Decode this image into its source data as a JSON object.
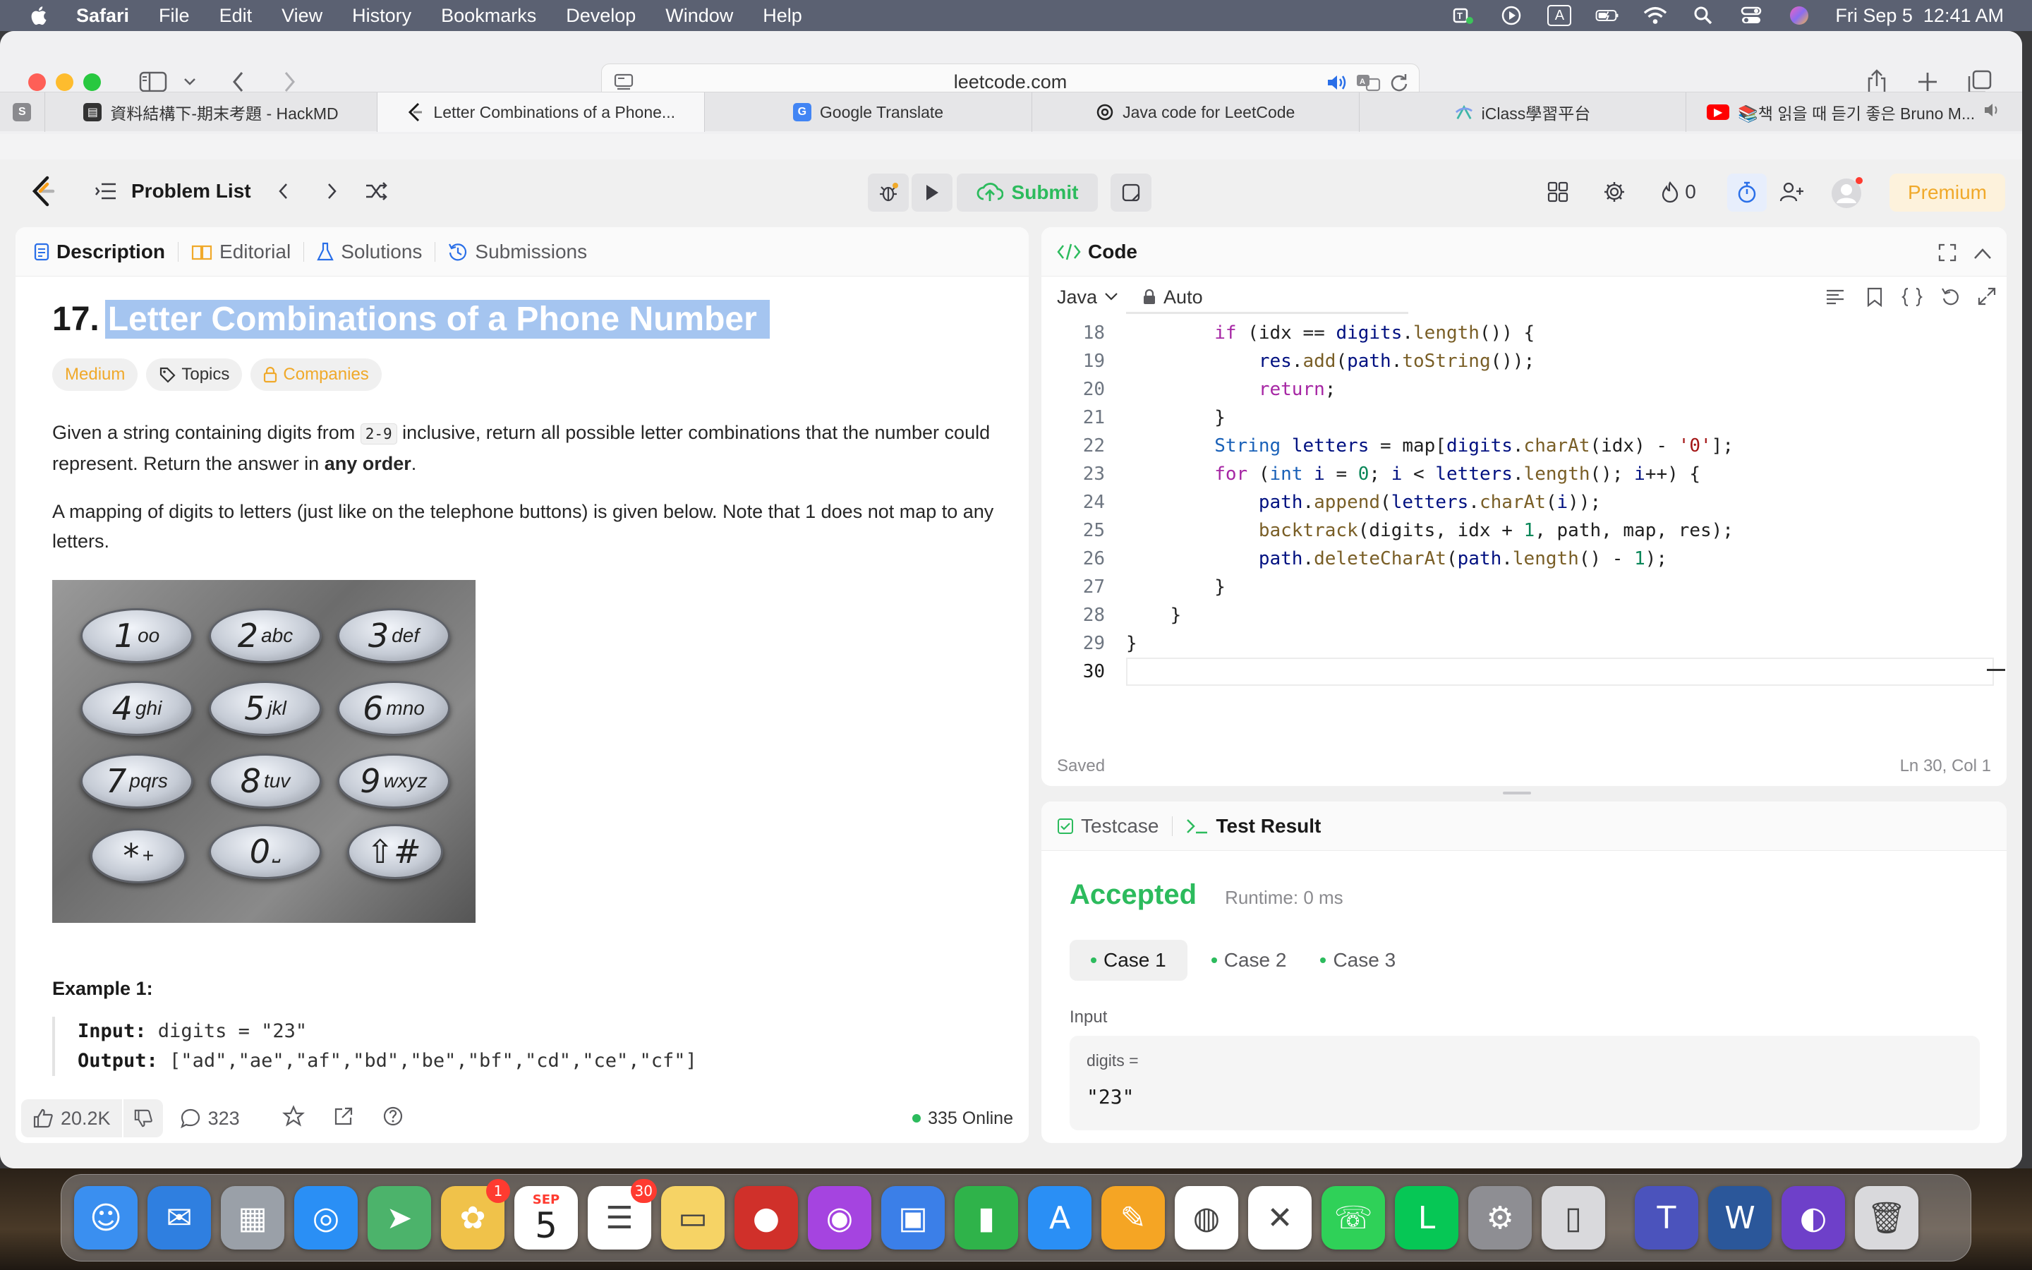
{
  "menubar": {
    "app": "Safari",
    "items": [
      "File",
      "Edit",
      "View",
      "History",
      "Bookmarks",
      "Develop",
      "Window",
      "Help"
    ],
    "clock": "Fri Sep 5  12:41 AM",
    "input_indicator": "A"
  },
  "browser": {
    "url": "leetcode.com",
    "tabs": [
      {
        "label": "資料結構下-期末考題 - HackMD",
        "icon": "hackmd-icon",
        "color": "#333333"
      },
      {
        "label": "Letter Combinations of a Phone...",
        "icon": "leetcode-icon",
        "color": "#f89f1b"
      },
      {
        "label": "Google Translate",
        "icon": "google-translate-icon",
        "color": "#4285f4"
      },
      {
        "label": "Java code for LeetCode",
        "icon": "chatgpt-icon",
        "color": "#222222"
      },
      {
        "label": "iClass學習平台",
        "icon": "iclass-icon",
        "color": "#3fb6a8"
      },
      {
        "label": "📚책 읽을 때 듣기 좋은 Bruno M...",
        "icon": "youtube-icon",
        "color": "#ff0000"
      }
    ],
    "pinned_tab": "S"
  },
  "leetcode": {
    "nav": {
      "problem_list": "Problem List",
      "submit": "Submit",
      "streak": "0",
      "premium": "Premium"
    },
    "description_tabs": [
      "Description",
      "Editorial",
      "Solutions",
      "Submissions"
    ],
    "problem": {
      "number": "17.",
      "title": "Letter Combinations of a Phone Number",
      "difficulty": "Medium",
      "topics": "Topics",
      "companies": "Companies",
      "para1_a": "Given a string containing digits from ",
      "para1_code": "2-9",
      "para1_b": " inclusive, return all possible letter combinations that the number could represent. Return the answer in ",
      "para1_bold": "any order",
      "para1_c": ".",
      "para2": "A mapping of digits to letters (just like on the telephone buttons) is given below. Note that 1 does not map to any letters.",
      "example_heading": "Example 1:",
      "example_input_label": "Input:",
      "example_input": " digits = \"23\"",
      "example_output_label": "Output:",
      "example_output": " [\"ad\",\"ae\",\"af\",\"bd\",\"be\",\"bf\",\"cd\",\"ce\",\"cf\"]"
    },
    "keypad": [
      {
        "d": "1",
        "l": "oo"
      },
      {
        "d": "2",
        "l": "abc"
      },
      {
        "d": "3",
        "l": "def"
      },
      {
        "d": "4",
        "l": "ghi"
      },
      {
        "d": "5",
        "l": "jkl"
      },
      {
        "d": "6",
        "l": "mno"
      },
      {
        "d": "7",
        "l": "pqrs"
      },
      {
        "d": "8",
        "l": "tuv"
      },
      {
        "d": "9",
        "l": "wxyz"
      },
      {
        "d": "*",
        "l": "+"
      },
      {
        "d": "0",
        "l": "⎵"
      },
      {
        "d": "⇧#",
        "l": ""
      }
    ],
    "footer": {
      "likes": "20.2K",
      "comments": "323",
      "online": "335 Online"
    },
    "code": {
      "title": "Code",
      "language": "Java",
      "mode": "Auto",
      "status": "Saved",
      "cursor": "Ln 30, Col 1",
      "line_numbers": [
        "18",
        "19",
        "20",
        "21",
        "22",
        "23",
        "24",
        "25",
        "26",
        "27",
        "28",
        "29",
        "30"
      ]
    },
    "testpanel": {
      "tab1": "Testcase",
      "tab2": "Test Result",
      "verdict": "Accepted",
      "runtime": "Runtime: 0 ms",
      "cases": [
        "Case 1",
        "Case 2",
        "Case 3"
      ],
      "input_label": "Input",
      "var_name": "digits =",
      "var_value": "\"23\""
    }
  },
  "dock": {
    "apps": [
      "Finder",
      "Mail",
      "Launchpad",
      "Safari",
      "Maps",
      "Photos",
      "Calendar",
      "Reminders",
      "Notes",
      "Photo Booth",
      "Podcasts",
      "Keynote",
      "Numbers",
      "App Store",
      "Pages",
      "Chrome",
      "iClass",
      "WhatsApp",
      "LINE",
      "System Settings",
      "iPhone Mirroring",
      "Teams",
      "Word",
      "GitHub Desktop",
      "Trash"
    ],
    "calendar_month": "SEP",
    "calendar_day": "5",
    "photos_badge": "1",
    "reminders_badge": "30"
  }
}
